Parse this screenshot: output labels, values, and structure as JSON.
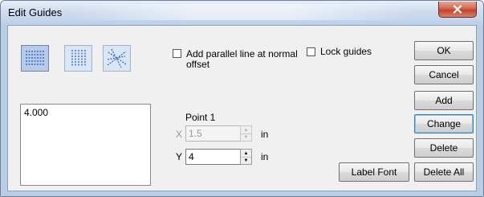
{
  "window": {
    "title": "Edit Guides"
  },
  "toolbar": {
    "tools": [
      {
        "icon": "horizontal-guides-icon",
        "selected": true
      },
      {
        "icon": "vertical-guides-icon",
        "selected": false
      },
      {
        "icon": "diagonal-guides-icon",
        "selected": false
      }
    ]
  },
  "options": {
    "parallel_line_label_1": "Add parallel line at normal",
    "parallel_line_label_2": "offset",
    "lock_guides_label": "Lock guides",
    "parallel_checked": false,
    "lock_checked": false
  },
  "guides_list": {
    "items": [
      "4.000"
    ]
  },
  "point": {
    "group_label": "Point 1",
    "x_label": "X",
    "x_value": "1.5",
    "x_unit": "in",
    "y_label": "Y",
    "y_value": "4",
    "y_unit": "in"
  },
  "buttons": {
    "ok": "OK",
    "cancel": "Cancel",
    "add": "Add",
    "change": "Change",
    "delete": "Delete",
    "delete_all": "Delete All",
    "label_font": "Label Font"
  },
  "colors": {
    "accent": "#3c7fb1",
    "tool_icon": "#3a68c8"
  }
}
